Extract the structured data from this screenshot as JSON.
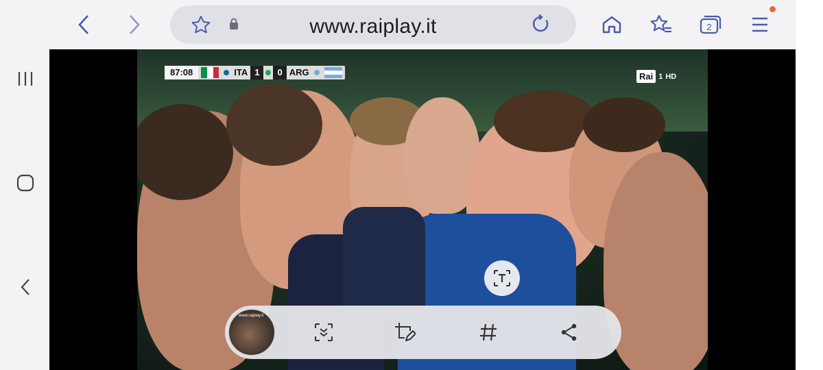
{
  "browser": {
    "url": "www.raiplay.it",
    "tab_count": "2",
    "accent_dot": "#f0663b",
    "icons": [
      "back-icon",
      "forward-icon",
      "bookmark-star-icon",
      "lock-icon",
      "reload-icon",
      "home-icon",
      "bookmarks-icon",
      "tabs-icon",
      "menu-icon"
    ]
  },
  "system_nav": {
    "icons": [
      "recents-icon",
      "home-icon",
      "back-icon"
    ]
  },
  "video": {
    "scoreboard": {
      "time": "87:08",
      "home_team": "ITA",
      "home_score": "1",
      "away_score": "0",
      "away_team": "ARG"
    },
    "channel": {
      "logo_text": "Rai",
      "number": "1",
      "quality": "HD"
    }
  },
  "capture_toolbar": {
    "thumbnail_caption": "www.raiplay.it",
    "icons": [
      "scroll-capture-icon",
      "draw-icon",
      "tag-icon",
      "share-icon"
    ]
  }
}
